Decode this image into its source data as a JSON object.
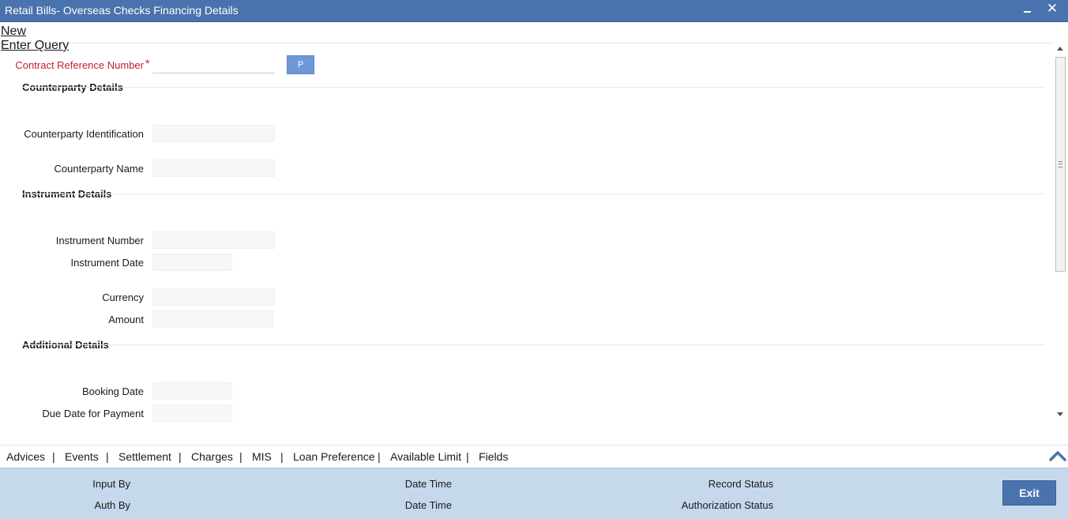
{
  "window": {
    "title": "Retail Bills- Overseas Checks Financing Details",
    "minimize_icon": "minimize-icon",
    "close_icon": "close-icon",
    "close_glyph": "✕"
  },
  "toolbar": {
    "new_label": "New",
    "enter_query_label": "Enter Query"
  },
  "form": {
    "contract_ref": {
      "label": "Contract Reference Number",
      "required_mark": "*",
      "value": "",
      "button_label": "P"
    },
    "counterparty_section": "Counterparty Details",
    "counterparty_id": {
      "label": "Counterparty Identification",
      "value": ""
    },
    "counterparty_name": {
      "label": "Counterparty Name",
      "value": ""
    },
    "instrument_section": "Instrument Details",
    "instrument_number": {
      "label": "Instrument Number",
      "value": ""
    },
    "instrument_date": {
      "label": "Instrument Date",
      "value": ""
    },
    "currency": {
      "label": "Currency",
      "value": ""
    },
    "amount": {
      "label": "Amount",
      "value": ""
    },
    "additional_section": "Additional Details",
    "booking_date": {
      "label": "Booking Date",
      "value": ""
    },
    "due_date": {
      "label": "Due Date for Payment",
      "value": ""
    }
  },
  "tabs": {
    "items": [
      "Advices",
      "Events",
      "Settlement",
      "Charges",
      "MIS",
      "Loan Preference",
      "Available Limit",
      "Fields"
    ],
    "separator": "|"
  },
  "footer": {
    "input_by": "Input By",
    "date_time_1": "Date Time",
    "record_status": "Record Status",
    "auth_by": "Auth By",
    "date_time_2": "Date Time",
    "authorization_status": "Authorization Status",
    "exit_label": "Exit"
  },
  "colors": {
    "title_bar": "#4a73ad",
    "required_label": "#c41f2b",
    "footer_bg": "#c6d9ec",
    "exit_button": "#4a73ad"
  }
}
